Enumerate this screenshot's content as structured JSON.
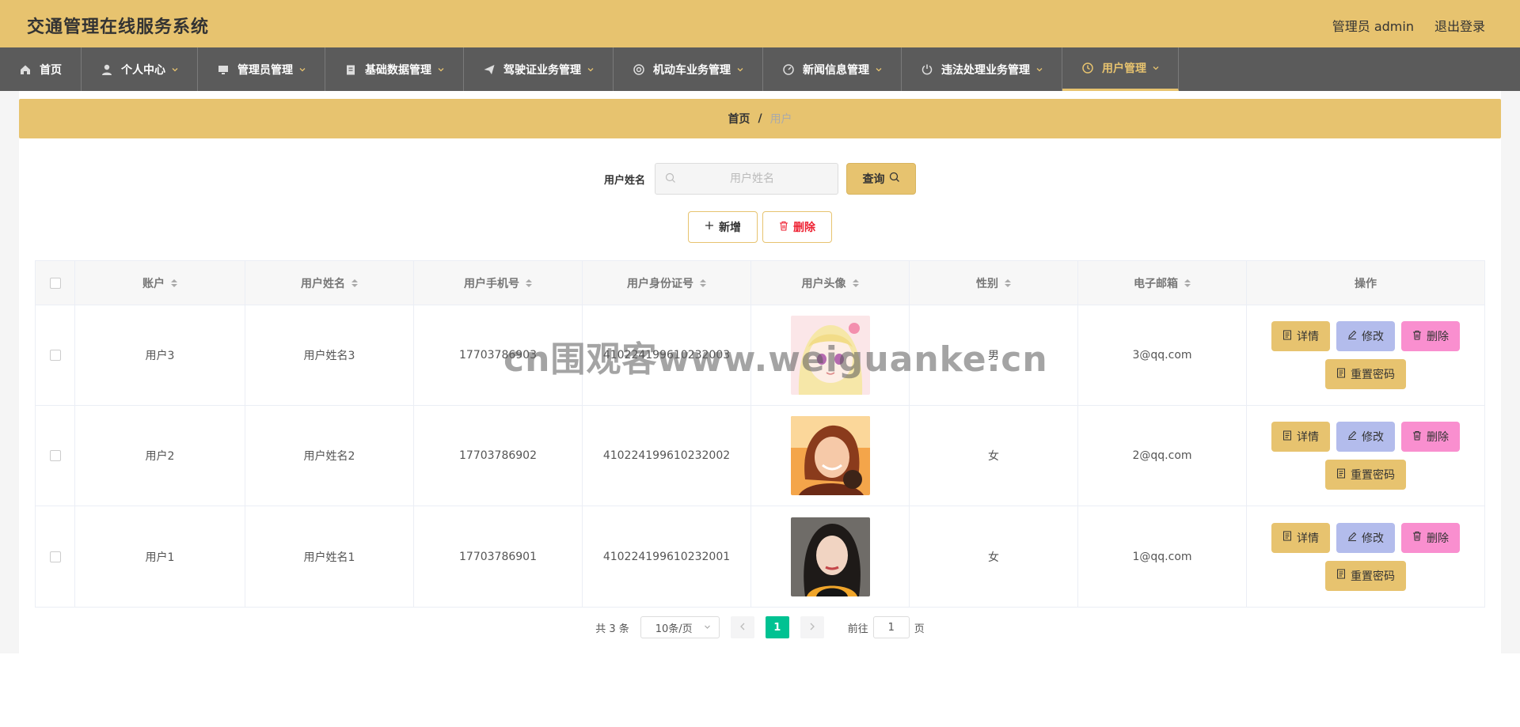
{
  "header": {
    "app_title": "交通管理在线服务系统",
    "user_label": "管理员 admin",
    "logout_label": "退出登录"
  },
  "nav": {
    "items": [
      {
        "label": "首页",
        "icon": "home-icon"
      },
      {
        "label": "个人中心",
        "icon": "user-icon"
      },
      {
        "label": "管理员管理",
        "icon": "monitor-icon"
      },
      {
        "label": "基础数据管理",
        "icon": "clipboard-icon"
      },
      {
        "label": "驾驶证业务管理",
        "icon": "send-icon"
      },
      {
        "label": "机动车业务管理",
        "icon": "wheel-icon"
      },
      {
        "label": "新闻信息管理",
        "icon": "gauge-icon"
      },
      {
        "label": "违法处理业务管理",
        "icon": "power-icon"
      },
      {
        "label": "用户管理",
        "icon": "clock-icon"
      }
    ],
    "active_color": "#e7c36f"
  },
  "breadcrumb": {
    "home": "首页",
    "separator": "/",
    "current": "用户"
  },
  "search": {
    "label": "用户姓名",
    "placeholder": "用户姓名",
    "value": "",
    "query_button": "查询"
  },
  "actions": {
    "add_label": "新增",
    "delete_label": "删除"
  },
  "table": {
    "columns": [
      "账户",
      "用户姓名",
      "用户手机号",
      "用户身份证号",
      "用户头像",
      "性别",
      "电子邮箱",
      "操作"
    ],
    "rows": [
      {
        "account": "用户3",
        "name": "用户姓名3",
        "phone": "17703786903",
        "id_card": "410224199610232003",
        "avatar": "avatar-anime-icon",
        "gender": "男",
        "email": "3@qq.com"
      },
      {
        "account": "用户2",
        "name": "用户姓名2",
        "phone": "17703786902",
        "id_card": "410224199610232002",
        "avatar": "avatar-woman-orange-icon",
        "gender": "女",
        "email": "2@qq.com"
      },
      {
        "account": "用户1",
        "name": "用户姓名1",
        "phone": "17703786901",
        "id_card": "410224199610232001",
        "avatar": "avatar-woman-dark-icon",
        "gender": "女",
        "email": "1@qq.com"
      }
    ],
    "ops": {
      "detail": "详情",
      "edit": "修改",
      "delete": "删除",
      "reset": "重置密码"
    }
  },
  "pagination": {
    "total_text": "共 3 条",
    "page_size": "10条/页",
    "current_page": "1",
    "goto_prefix": "前往",
    "goto_value": "1",
    "goto_suffix": "页"
  },
  "watermark": "cn围观客www.weiguanke.cn",
  "colors": {
    "primary": "#e7c36f",
    "nav_bg": "#5b5b5b",
    "edit": "#b3bcec",
    "delete": "#f98fcf",
    "page_active": "#00c292"
  }
}
